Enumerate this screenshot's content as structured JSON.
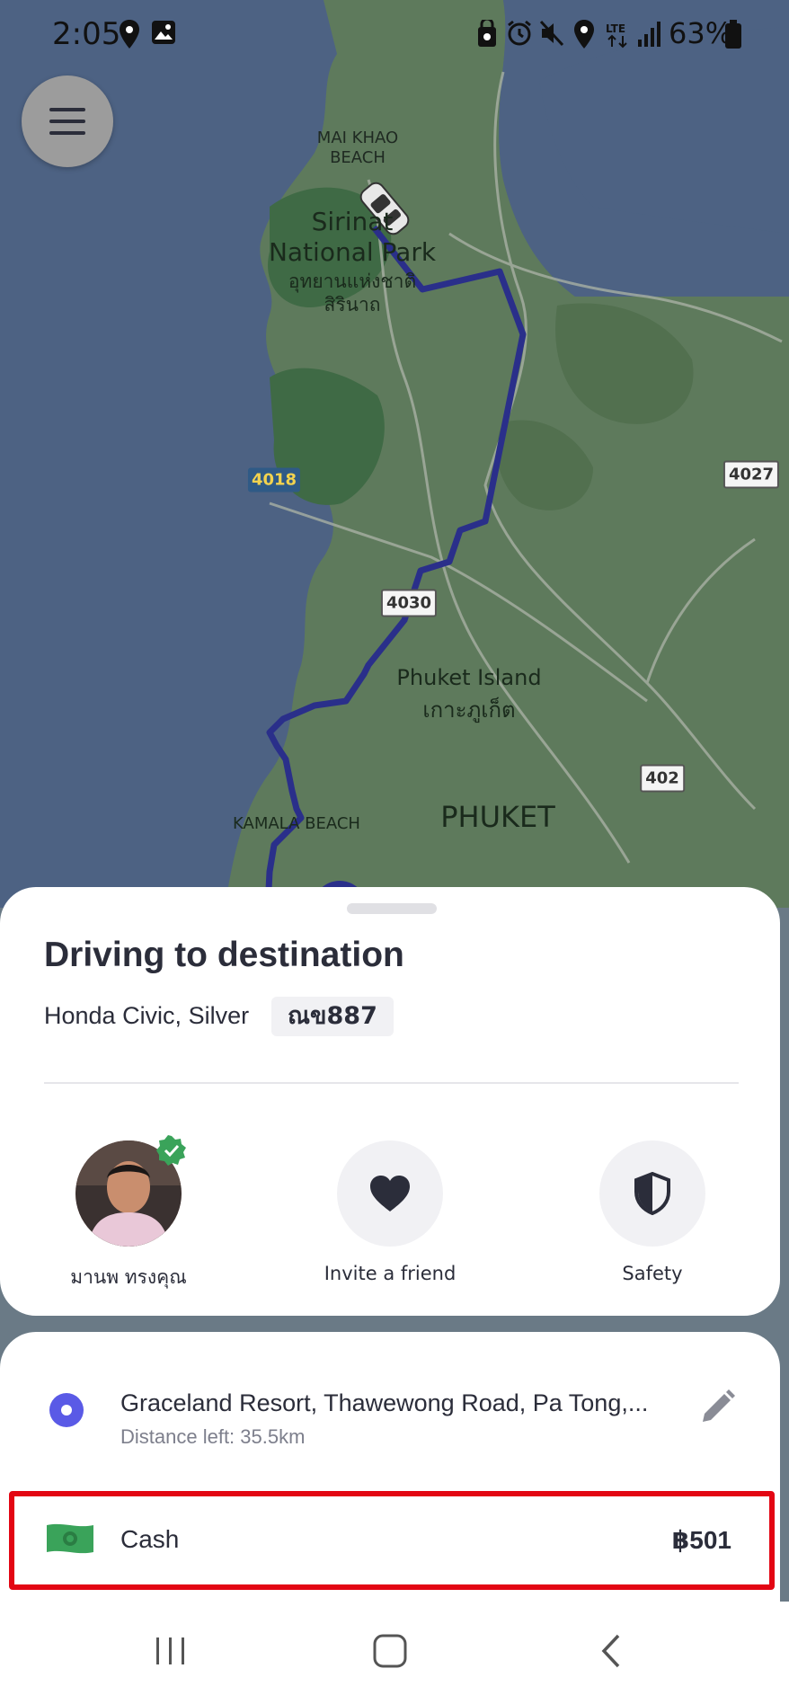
{
  "status_bar": {
    "time": "2:05",
    "battery_percent": "63%",
    "icons": [
      "location-icon",
      "image-icon",
      "lock-icon",
      "alarm-icon",
      "mute-icon",
      "location-icon",
      "lte-icon",
      "signal-icon",
      "battery-icon"
    ]
  },
  "map": {
    "labels": {
      "mai_khao": "MAI KHAO\nBEACH",
      "sirinat_en": "Sirinat\nNational Park",
      "sirinat_th": "อุทยานแห่งชาติ\nสิรินาถ",
      "phuket_island_en": "Phuket Island",
      "phuket_island_th": "เกาะภูเก็ต",
      "phuket": "PHUKET",
      "kamala": "KAMALA BEACH"
    },
    "road_shields": [
      "4018",
      "4030",
      "4027",
      "402"
    ],
    "colors": {
      "water": "#4d6283",
      "land": "#5e7a5c",
      "park": "#3f6a45",
      "route": "#2a2f8a"
    }
  },
  "menu_button": {
    "icon": "hamburger-icon"
  },
  "trip": {
    "title": "Driving to destination",
    "vehicle": "Honda Civic, Silver",
    "plate": "ณข887"
  },
  "actions": {
    "driver_name": "มานพ ทรงคุณ",
    "invite_label": "Invite a friend",
    "safety_label": "Safety"
  },
  "destination": {
    "address": "Graceland Resort, Thawewong Road, Pa Tong,...",
    "distance": "Distance left: 35.5km"
  },
  "payment": {
    "method": "Cash",
    "fare": "฿501",
    "highlight_color": "#e30613"
  },
  "nav_bar": {
    "buttons": [
      "recent-apps-icon",
      "home-icon",
      "back-icon"
    ]
  }
}
